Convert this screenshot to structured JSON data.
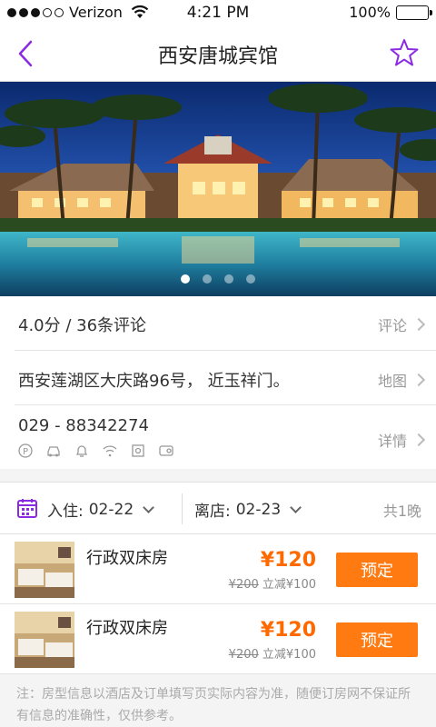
{
  "status_bar": {
    "carrier": "Verizon",
    "time": "4:21 PM",
    "battery": "100%"
  },
  "nav": {
    "title": "西安唐城宾馆",
    "back_icon": "chevron-left-icon",
    "favorite_icon": "star-icon",
    "accent_color": "#8a2be2"
  },
  "hero": {
    "page_count": 4,
    "active_page": 1
  },
  "info": {
    "rating_text": "4.0分 / 36条评论",
    "reviews_link": "评论",
    "address": "西安莲湖区大庆路96号， 近玉祥门。",
    "map_link": "地图",
    "phone": "029 - 88342274",
    "details_link": "详情",
    "amenities": [
      "parking-icon",
      "car-icon",
      "bell-icon",
      "wifi-icon",
      "safe-icon",
      "tv-icon"
    ]
  },
  "dates": {
    "checkin_label": "入住:",
    "checkin_value": "02-22",
    "checkout_label": "离店:",
    "checkout_value": "02-23",
    "nights": "共1晚"
  },
  "rooms": [
    {
      "name": "行政双床房",
      "price": "¥120",
      "original_price": "¥200",
      "discount": "立减¥100",
      "book_label": "预定"
    },
    {
      "name": "行政双床房",
      "price": "¥120",
      "original_price": "¥200",
      "discount": "立减¥100",
      "book_label": "预定"
    }
  ],
  "note": "注：房型信息以酒店及订单填写页实际内容为准，随便订房网不保证所有信息的准确性，仅供参考。",
  "colors": {
    "accent": "#8a2be2",
    "price": "#ff6a00",
    "book_button": "#ff7a10"
  }
}
